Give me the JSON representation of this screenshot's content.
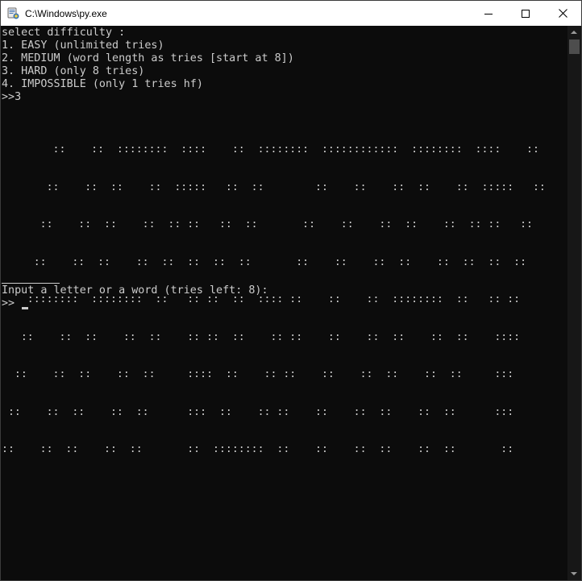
{
  "window": {
    "title": "C:\\Windows\\py.exe",
    "icon": "python-icon",
    "controls": [
      "minimize-icon",
      "maximize-icon",
      "close-icon"
    ]
  },
  "console": {
    "menu_lines": [
      "select difficulty :",
      "1. EASY (unlimited tries)",
      "2. MEDIUM (word length as tries [start at 8])",
      "3. HARD (only 8 tries)",
      "4. IMPOSSIBLE (only 1 tries hf)",
      ">>3"
    ],
    "ascii_art": [
      "        ::    ::  ::::::::  ::::    ::  ::::::::  ::::::::::::  ::::::::  ::::    ::",
      "       ::    ::  ::    ::  :::::   ::  ::        ::    ::    ::  ::    ::  :::::   ::",
      "      ::    ::  ::    ::  :: ::   ::  ::       ::    ::    ::  ::    ::  :: ::   ::",
      "     ::    ::  ::    ::  ::  ::  ::  ::       ::    ::    ::  ::    ::  ::  ::  ::",
      "    ::::::::  ::::::::  ::   :: ::  ::  :::: ::    ::    ::  ::::::::  ::   :: ::",
      "   ::    ::  ::    ::  ::    :: ::  ::    :: ::    ::    ::  ::    ::  ::    ::::",
      "  ::    ::  ::    ::  ::     ::::  ::    :: ::    ::    ::  ::    ::  ::     :::",
      " ::    ::  ::    ::  ::      :::  ::    :: ::    ::    ::  ::    ::  ::      :::",
      "::    ::  ::    ::  ::       ::  ::::::::  ::    ::    ::  ::    ::  ::       ::"
    ],
    "prompt_line": "Input a letter or a word (tries left: 8):",
    "input_prefix": ">>",
    "input_value": ""
  },
  "colors": {
    "background": "#0c0c0c",
    "text": "#cccccc",
    "titlebar": "#ffffff"
  }
}
